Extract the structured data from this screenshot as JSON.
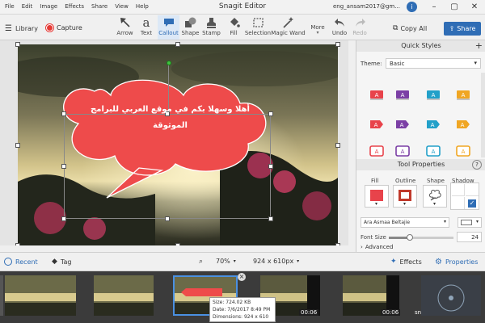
{
  "menu": [
    "File",
    "Edit",
    "Image",
    "Effects",
    "Share",
    "View",
    "Help"
  ],
  "window_title": "Snagit Editor",
  "account": "eng_ansam2017@gm...",
  "info_label": "i",
  "toolbar": {
    "library": "Library",
    "capture": "Capture",
    "tools": [
      "Arrow",
      "Text",
      "Callout",
      "Shape",
      "Stamp",
      "Fill",
      "Selection",
      "Magic Wand"
    ],
    "more": "More",
    "undo": "Undo",
    "redo": "Redo",
    "copy_all": "Copy All",
    "share": "Share"
  },
  "callout_text": "أهلا وسهلا بكم في موقع العربي للبرامج الموثوقة",
  "quick_styles": {
    "title": "Quick Styles",
    "theme_label": "Theme:",
    "theme_value": "Basic",
    "glyph": "A",
    "colors": [
      "#e8434b",
      "#7b3fa5",
      "#22a0c9",
      "#f0a623",
      "#e8434b",
      "#7b3fa5",
      "#22a0c9",
      "#f0a623",
      "#e8434b",
      "#7b3fa5",
      "#22a0c9",
      "#f0a623"
    ],
    "shapes": [
      "rect",
      "rect",
      "rect",
      "rect",
      "arrow",
      "arrow",
      "arrow",
      "arrow",
      "outline",
      "outline",
      "outline",
      "outline"
    ]
  },
  "tool_properties": {
    "title": "Tool Properties",
    "help_label": "?",
    "fill_label": "Fill",
    "outline_label": "Outline",
    "shape_label": "Shape",
    "shadow_label": "Shadow",
    "fill_color": "#e8434b",
    "outline_color": "#c0392b",
    "font_name": "Ara Asmaa Beltajie",
    "font_size_label": "Font Size",
    "font_size": "24",
    "font_size_level": 0.33,
    "advanced": "Advanced"
  },
  "bottom": {
    "recent": "Recent",
    "tag": "Tag",
    "zoom": "70%",
    "dimensions": "924 x 610px",
    "effects": "Effects",
    "properties": "Properties"
  },
  "tray": {
    "durations": [
      "00:06",
      "00:06"
    ],
    "snag": "snag",
    "tooltip": {
      "size": "Size: 724.02 KB",
      "date": "Date: 7/6/2017 8:49 PM",
      "dims": "Dimensions: 924 x 610"
    }
  },
  "colors": {
    "accent": "#2f6db5",
    "callout": "#ee4b4b",
    "record": "#e53935"
  }
}
